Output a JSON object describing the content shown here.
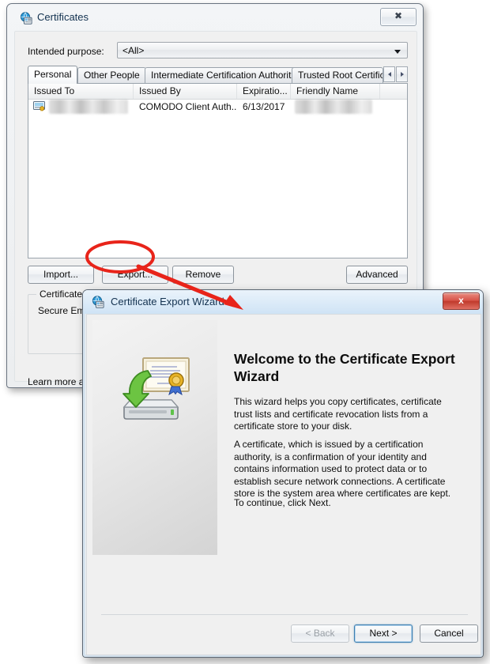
{
  "certificates_dialog": {
    "title": "Certificates",
    "title_icon": "certificate-globe-icon",
    "close_label": "✖",
    "intended_purpose": {
      "label": "Intended purpose:",
      "value": "<All>"
    },
    "tabs": [
      {
        "label": "Personal",
        "selected": true
      },
      {
        "label": "Other People",
        "selected": false
      },
      {
        "label": "Intermediate Certification Authorities",
        "selected": false
      },
      {
        "label": "Trusted Root Certification",
        "selected": false
      }
    ],
    "tab_scroll_left": "◀",
    "tab_scroll_right": "▶",
    "listview": {
      "columns": [
        "Issued To",
        "Issued By",
        "Expiratio...",
        "Friendly Name",
        ""
      ],
      "rows": [
        {
          "icon": "certificate-icon",
          "issued_to": "Yuliya Sadikova",
          "issued_to_redacted": true,
          "issued_by": "COMODO Client Auth...",
          "expiration_date": "6/13/2017",
          "friendly_name": "Yuliya Sadikova",
          "friendly_name_redacted": true
        }
      ]
    },
    "buttons": {
      "import": "Import...",
      "export": "Export...",
      "remove": "Remove",
      "advanced": "Advanced"
    },
    "purposes_group": {
      "title": "Certificate intended purposes",
      "value": "Secure Email,"
    },
    "learn_more": "Learn more abo"
  },
  "wizard": {
    "title": "Certificate Export Wizard",
    "title_icon": "certificate-globe-icon",
    "close_label": "x",
    "banner_icon": "certificate-to-disk-icon",
    "heading": "Welcome to the Certificate Export Wizard",
    "paragraphs": [
      "This wizard helps you copy certificates, certificate trust lists and certificate revocation lists from a certificate store to your disk.",
      "A certificate, which is issued by a certification authority, is a confirmation of your identity and contains information used to protect data or to establish secure network connections. A certificate store is the system area where certificates are kept.",
      "To continue, click Next."
    ],
    "buttons": {
      "back": "< Back",
      "next": "Next >",
      "cancel": "Cancel"
    }
  },
  "annotation": {
    "color": "#e8241a",
    "ellipse_target": "export-button",
    "arrow_target": "wizard-titlebar"
  }
}
